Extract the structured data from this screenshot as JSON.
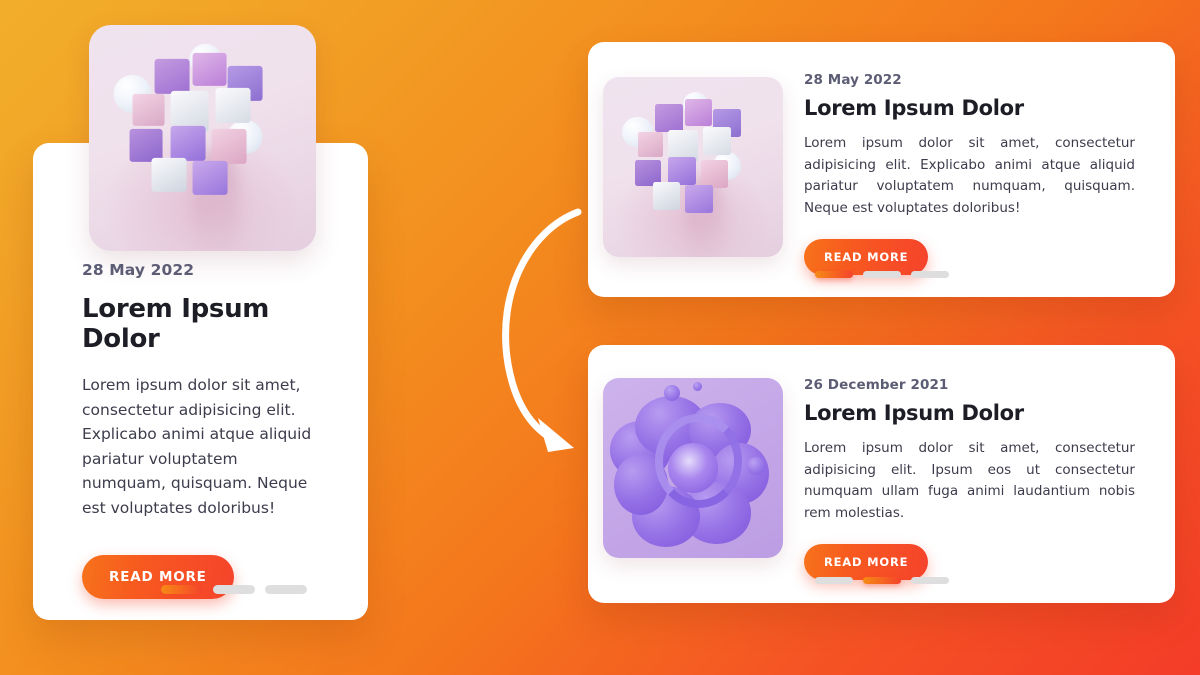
{
  "theme": {
    "background_gradient_start": "#F2AE2A",
    "background_gradient_end": "#F43C28",
    "accent_gradient_start": "#F78A16",
    "accent_gradient_end": "#F4432B",
    "card_background": "#FFFFFF",
    "date_text_color": "#5C5C74",
    "title_text_color": "#1D1D26",
    "body_text_color": "#3C3C4C",
    "dot_inactive_color": "#DEDEDE"
  },
  "featured_card": {
    "date": "28 May 2022",
    "title": "Lorem Ipsum Dolor",
    "excerpt": "Lorem ipsum dolor sit amet, consectetur adipisicing elit. Explicabo animi atque aliquid pariatur voluptatem numquam, quisquam. Neque est voluptates doloribus!",
    "button_label": "READ MORE",
    "image_alt": "3d-cube-artwork",
    "pagination": {
      "total": 3,
      "active_index": 0
    }
  },
  "list_cards": [
    {
      "date": "28 May 2022",
      "title": "Lorem Ipsum Dolor",
      "excerpt": "Lorem ipsum dolor sit amet, consectetur adipisicing elit. Explicabo animi atque aliquid pariatur voluptatem numquam, quisquam. Neque est voluptates doloribus!",
      "button_label": "READ MORE",
      "image_alt": "3d-cube-artwork",
      "pagination": {
        "total": 3,
        "active_index": 0
      }
    },
    {
      "date": "26 December 2021",
      "title": "Lorem Ipsum Dolor",
      "excerpt": "Lorem ipsum dolor sit amet, consectetur adipisicing elit. Ipsum eos ut consectetur numquam ullam fuga animi laudantium nobis rem molestias.",
      "button_label": "READ MORE",
      "image_alt": "purple-blob-artwork",
      "pagination": {
        "total": 3,
        "active_index": 1
      }
    }
  ],
  "annotation": {
    "arrow_name": "curved-down-right-arrow",
    "arrow_color": "#FFFFFF"
  }
}
